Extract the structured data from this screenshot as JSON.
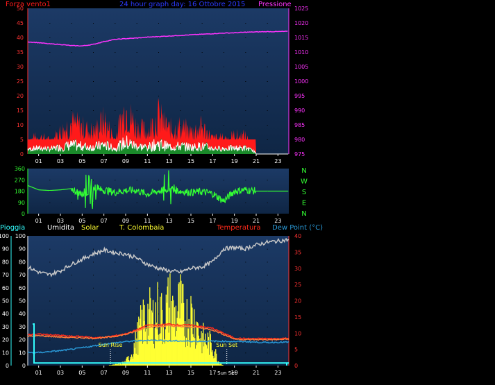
{
  "colors": {
    "background": "#000000",
    "panel_top": "#1c3a66",
    "panel_bottom": "#0f2645",
    "wind": "#ff1a1a",
    "wind_avg": "#1a8a2a",
    "wind_gust_line": "#ffffff",
    "pressure": "#ff33ff",
    "direction": "#33ff33",
    "humidity": "#c8c8c8",
    "solar": "#ffff33",
    "temperature": "#ff2a1a",
    "dewpoint": "#2a9ad8",
    "rain": "#33ffff",
    "title": "#2a3aff",
    "rain_axis": "#33ffff"
  },
  "chart_data": [
    {
      "type": "area",
      "title": "24 hour graph day: 16 Ottobre 2015",
      "left_label": "Forza vento1",
      "right_label": "Pressione",
      "x_ticks": [
        "01",
        "03",
        "05",
        "07",
        "09",
        "11",
        "13",
        "15",
        "17",
        "19",
        "21",
        "23"
      ],
      "y_left_ticks": [
        "0",
        "5",
        "10",
        "15",
        "20",
        "25",
        "30",
        "35",
        "40",
        "45",
        "50"
      ],
      "y_right_ticks": [
        "975",
        "980",
        "985",
        "990",
        "995",
        "1000",
        "1005",
        "1010",
        "1015",
        "1020",
        "1025"
      ],
      "ylim_left": [
        0,
        50
      ],
      "ylim_right": [
        975,
        1025
      ],
      "xlim": [
        0,
        24
      ],
      "series": [
        {
          "name": "Forza vento1",
          "axis": "left",
          "x": [
            0,
            1,
            2,
            3,
            4,
            5,
            6,
            7,
            8,
            9,
            10,
            11,
            12,
            13,
            14,
            15,
            16,
            17,
            18,
            19,
            20,
            21,
            22,
            23,
            24
          ],
          "values": [
            5,
            7,
            5,
            9,
            13,
            11,
            9,
            14,
            6,
            19,
            11,
            9,
            16,
            10,
            11,
            9,
            11,
            6,
            6,
            7,
            7,
            0,
            0,
            0,
            0
          ]
        },
        {
          "name": "Pressione",
          "axis": "right",
          "x": [
            0,
            1,
            2,
            3,
            4,
            5,
            6,
            7,
            8,
            9,
            10,
            11,
            12,
            13,
            14,
            15,
            16,
            17,
            18,
            19,
            20,
            21,
            22,
            23,
            24
          ],
          "values": [
            1013.5,
            1013.2,
            1012.8,
            1012.6,
            1012.2,
            1012.1,
            1012.6,
            1013.6,
            1014.3,
            1014.6,
            1014.8,
            1015.1,
            1015.3,
            1015.5,
            1015.7,
            1015.9,
            1016.1,
            1016.3,
            1016.5,
            1016.6,
            1016.8,
            1016.9,
            1017.0,
            1017.0,
            1017.1
          ]
        }
      ]
    },
    {
      "type": "line",
      "right_labels": [
        "N",
        "W",
        "S",
        "E",
        "N"
      ],
      "x_ticks": [
        "01",
        "03",
        "05",
        "07",
        "09",
        "11",
        "13",
        "15",
        "17",
        "19",
        "21",
        "23"
      ],
      "y_ticks": [
        "0",
        "90",
        "180",
        "270",
        "360"
      ],
      "ylim": [
        0,
        360
      ],
      "xlim": [
        0,
        24
      ],
      "series": [
        {
          "name": "direction",
          "x": [
            0,
            1,
            2,
            3,
            4,
            5,
            6,
            7,
            8,
            9,
            10,
            11,
            12,
            13,
            14,
            15,
            16,
            17,
            18,
            19,
            20,
            21,
            22,
            23,
            24
          ],
          "values": [
            225,
            190,
            185,
            190,
            200,
            150,
            190,
            190,
            170,
            185,
            185,
            155,
            180,
            200,
            180,
            170,
            175,
            160,
            100,
            180,
            190,
            180,
            180,
            180,
            180
          ]
        }
      ]
    },
    {
      "type": "line",
      "legend": [
        "Pioggia",
        "Umidita",
        "Solar",
        "T. Colombaia",
        "Temperatura",
        "Dew Point (°C)"
      ],
      "x_ticks": [
        "01",
        "03",
        "05",
        "07",
        "09",
        "11",
        "13",
        "15",
        "17",
        "19",
        "21",
        "23"
      ],
      "y_left_ticks": [
        "0",
        "10",
        "20",
        "30",
        "40",
        "50",
        "60",
        "70",
        "80",
        "90",
        "100"
      ],
      "y_left2_ticks": [
        "0",
        "10",
        "20",
        "30",
        "40",
        "50",
        "60",
        "70",
        "80",
        "90",
        "100"
      ],
      "y_right_ticks": [
        "0",
        "5",
        "10",
        "15",
        "20",
        "25",
        "30",
        "35",
        "40"
      ],
      "ylim_left": [
        0,
        100
      ],
      "ylim_right": [
        0,
        40
      ],
      "xlim": [
        0,
        24
      ],
      "annotations": [
        {
          "label": "Sun Rise",
          "x": 7.6
        },
        {
          "label": "Sun Set",
          "x": 18.3
        }
      ],
      "series": [
        {
          "name": "Umidita",
          "axis": "left",
          "x": [
            0,
            1,
            2,
            3,
            4,
            5,
            6,
            7,
            8,
            9,
            10,
            11,
            12,
            13,
            14,
            15,
            16,
            17,
            18,
            19,
            20,
            21,
            22,
            23,
            24
          ],
          "values": [
            76,
            72,
            70,
            73,
            78,
            82,
            86,
            89,
            87,
            86,
            83,
            78,
            75,
            73,
            72,
            75,
            76,
            80,
            90,
            91,
            90,
            93,
            95,
            96,
            97
          ]
        },
        {
          "name": "Solar",
          "axis": "left",
          "x": [
            7,
            8,
            8.5,
            9,
            9.5,
            10,
            10.5,
            11,
            11.5,
            12,
            12.5,
            13,
            13.5,
            14,
            14.5,
            15,
            15.5,
            16,
            16.5,
            17,
            17.5,
            18
          ],
          "values": [
            0,
            1,
            2,
            4,
            12,
            28,
            45,
            55,
            50,
            60,
            48,
            68,
            52,
            65,
            50,
            55,
            45,
            30,
            26,
            22,
            5,
            0
          ]
        },
        {
          "name": "T. Colombaia",
          "axis": "right",
          "x": [
            0,
            1,
            2,
            3,
            4,
            5,
            6,
            7,
            8,
            9,
            10,
            11,
            12,
            13,
            14,
            15,
            16,
            17,
            18,
            19,
            20,
            21,
            22,
            23,
            24
          ],
          "values": [
            9.5,
            9.7,
            9.5,
            9.3,
            9.0,
            9.0,
            8.6,
            8.7,
            9.2,
            9.8,
            11.0,
            12.5,
            12.5,
            12.8,
            12.5,
            12.5,
            12.0,
            11.5,
            10.0,
            8.5,
            8.3,
            8.3,
            8.3,
            8.3,
            8.5
          ]
        },
        {
          "name": "Temperatura",
          "axis": "right",
          "x": [
            0,
            1,
            2,
            3,
            4,
            5,
            6,
            7,
            8,
            9,
            10,
            11,
            12,
            13,
            14,
            15,
            16,
            17,
            18,
            19,
            20,
            21,
            22,
            23,
            24
          ],
          "values": [
            9.0,
            9.2,
            9.0,
            8.8,
            8.6,
            8.6,
            8.4,
            8.6,
            9.0,
            9.6,
            10.6,
            12.0,
            12.0,
            12.3,
            12.0,
            12.0,
            11.6,
            11.0,
            9.6,
            8.2,
            8.0,
            8.0,
            8.0,
            8.0,
            8.2
          ]
        },
        {
          "name": "Dew Point (°C)",
          "axis": "right",
          "x": [
            0,
            1,
            2,
            3,
            4,
            5,
            6,
            7,
            8,
            9,
            10,
            11,
            12,
            13,
            14,
            15,
            16,
            17,
            18,
            19,
            20,
            21,
            22,
            23,
            24
          ],
          "values": [
            4.0,
            4.0,
            4.3,
            4.6,
            5.0,
            5.5,
            6.0,
            6.6,
            7.0,
            7.4,
            7.6,
            7.8,
            7.8,
            7.6,
            7.6,
            7.5,
            7.5,
            7.5,
            7.5,
            7.4,
            7.4,
            7.2,
            7.1,
            7.2,
            7.2
          ]
        },
        {
          "name": "Pioggia",
          "axis": "left",
          "x": [
            0,
            0.1,
            0.1,
            24
          ],
          "values": [
            32,
            32,
            2,
            2
          ]
        }
      ]
    }
  ]
}
